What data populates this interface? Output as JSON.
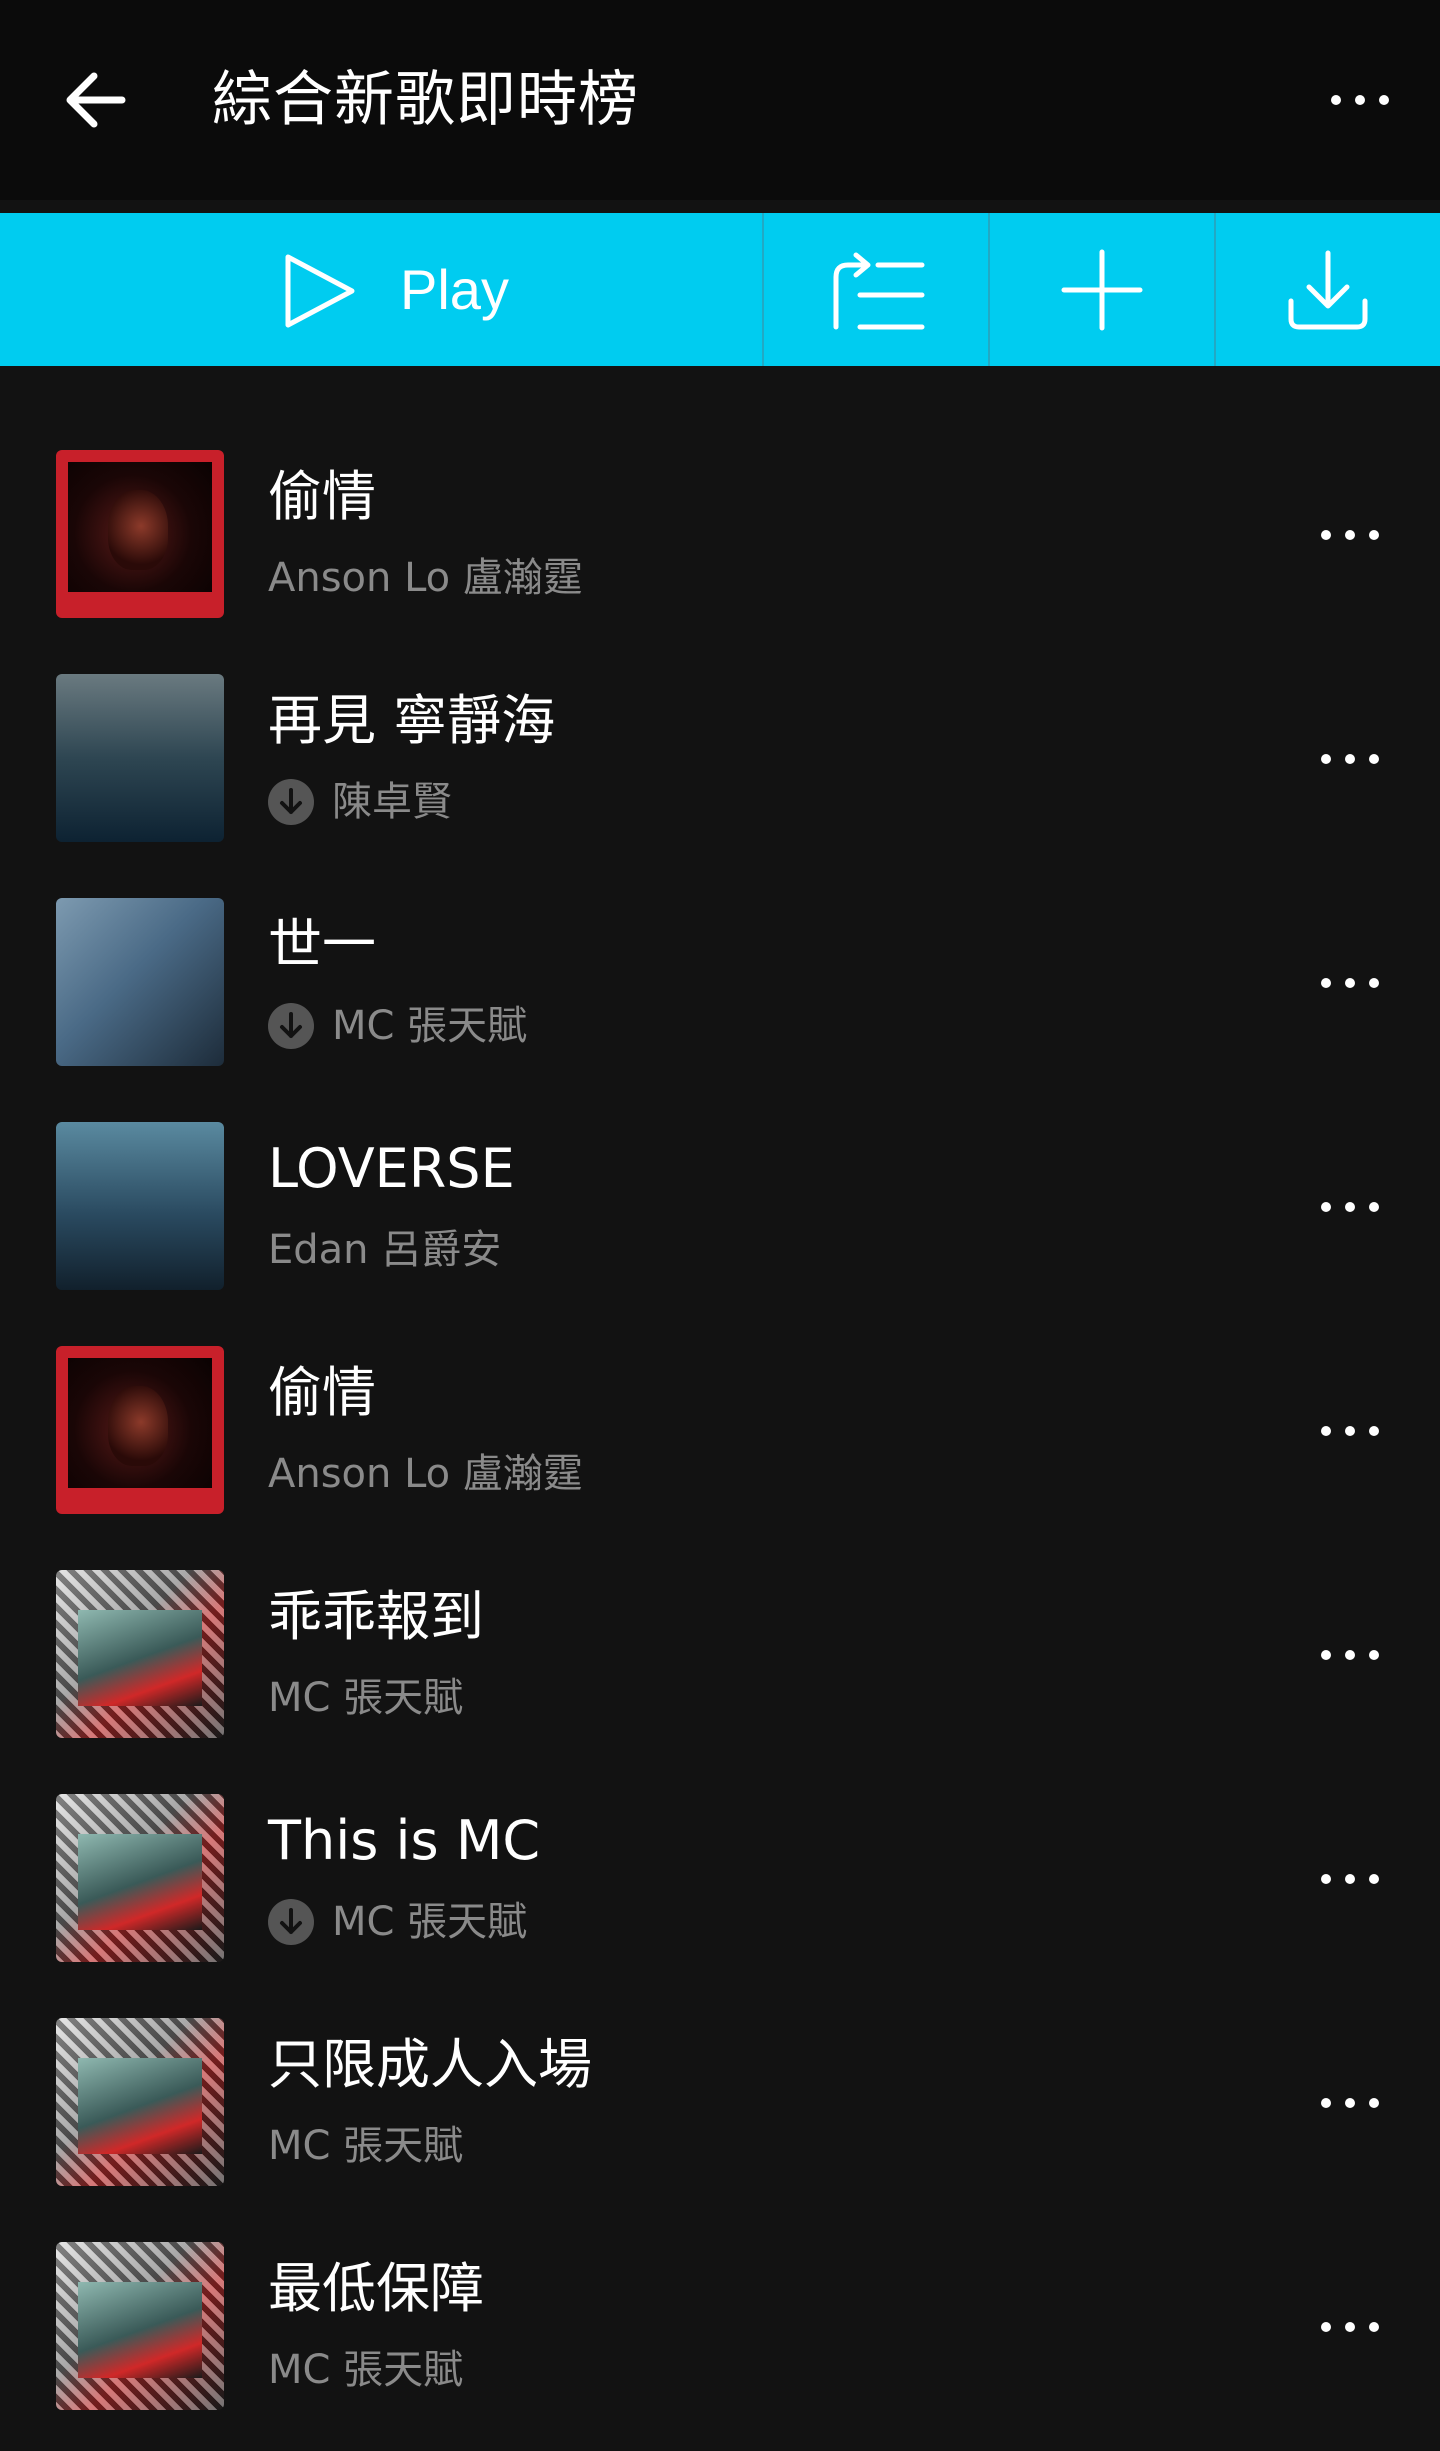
{
  "header": {
    "title": "綜合新歌即時榜"
  },
  "actionbar": {
    "play_label": "Play"
  },
  "colors": {
    "accent": "#00ccf0",
    "background": "#121212",
    "secondary_text": "#8a8a8a"
  },
  "songs": [
    {
      "title": "偷情",
      "artist": "Anson Lo 盧瀚霆",
      "downloaded": false,
      "cover": "red"
    },
    {
      "title": "再見 寧靜海",
      "artist": "陳卓賢",
      "downloaded": true,
      "cover": "blue1"
    },
    {
      "title": "世一",
      "artist": "MC 張天賦",
      "downloaded": true,
      "cover": "blue2"
    },
    {
      "title": "LOVERSE",
      "artist": "Edan 呂爵安",
      "downloaded": false,
      "cover": "cyan"
    },
    {
      "title": "偷情",
      "artist": "Anson Lo 盧瀚霆",
      "downloaded": false,
      "cover": "red"
    },
    {
      "title": "乖乖報到",
      "artist": "MC 張天賦",
      "downloaded": false,
      "cover": "collage"
    },
    {
      "title": "This is MC",
      "artist": "MC 張天賦",
      "downloaded": true,
      "cover": "collage"
    },
    {
      "title": "只限成人入場",
      "artist": "MC 張天賦",
      "downloaded": false,
      "cover": "collage"
    },
    {
      "title": "最低保障",
      "artist": "MC 張天賦",
      "downloaded": false,
      "cover": "collage"
    }
  ]
}
